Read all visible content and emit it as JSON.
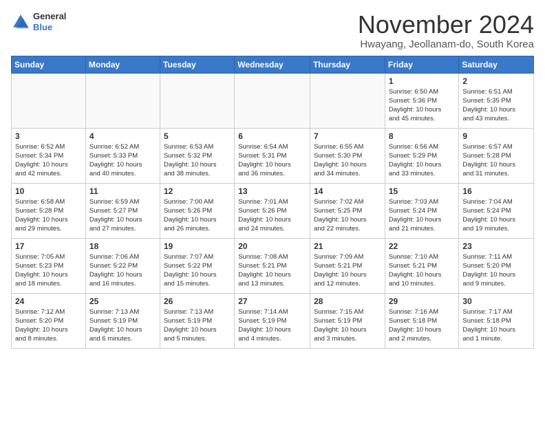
{
  "logo": {
    "general": "General",
    "blue": "Blue"
  },
  "title": "November 2024",
  "location": "Hwayang, Jeollanam-do, South Korea",
  "weekdays": [
    "Sunday",
    "Monday",
    "Tuesday",
    "Wednesday",
    "Thursday",
    "Friday",
    "Saturday"
  ],
  "weeks": [
    [
      {
        "day": "",
        "info": ""
      },
      {
        "day": "",
        "info": ""
      },
      {
        "day": "",
        "info": ""
      },
      {
        "day": "",
        "info": ""
      },
      {
        "day": "",
        "info": ""
      },
      {
        "day": "1",
        "info": "Sunrise: 6:50 AM\nSunset: 5:36 PM\nDaylight: 10 hours\nand 45 minutes."
      },
      {
        "day": "2",
        "info": "Sunrise: 6:51 AM\nSunset: 5:35 PM\nDaylight: 10 hours\nand 43 minutes."
      }
    ],
    [
      {
        "day": "3",
        "info": "Sunrise: 6:52 AM\nSunset: 5:34 PM\nDaylight: 10 hours\nand 42 minutes."
      },
      {
        "day": "4",
        "info": "Sunrise: 6:52 AM\nSunset: 5:33 PM\nDaylight: 10 hours\nand 40 minutes."
      },
      {
        "day": "5",
        "info": "Sunrise: 6:53 AM\nSunset: 5:32 PM\nDaylight: 10 hours\nand 38 minutes."
      },
      {
        "day": "6",
        "info": "Sunrise: 6:54 AM\nSunset: 5:31 PM\nDaylight: 10 hours\nand 36 minutes."
      },
      {
        "day": "7",
        "info": "Sunrise: 6:55 AM\nSunset: 5:30 PM\nDaylight: 10 hours\nand 34 minutes."
      },
      {
        "day": "8",
        "info": "Sunrise: 6:56 AM\nSunset: 5:29 PM\nDaylight: 10 hours\nand 33 minutes."
      },
      {
        "day": "9",
        "info": "Sunrise: 6:57 AM\nSunset: 5:28 PM\nDaylight: 10 hours\nand 31 minutes."
      }
    ],
    [
      {
        "day": "10",
        "info": "Sunrise: 6:58 AM\nSunset: 5:28 PM\nDaylight: 10 hours\nand 29 minutes."
      },
      {
        "day": "11",
        "info": "Sunrise: 6:59 AM\nSunset: 5:27 PM\nDaylight: 10 hours\nand 27 minutes."
      },
      {
        "day": "12",
        "info": "Sunrise: 7:00 AM\nSunset: 5:26 PM\nDaylight: 10 hours\nand 26 minutes."
      },
      {
        "day": "13",
        "info": "Sunrise: 7:01 AM\nSunset: 5:26 PM\nDaylight: 10 hours\nand 24 minutes."
      },
      {
        "day": "14",
        "info": "Sunrise: 7:02 AM\nSunset: 5:25 PM\nDaylight: 10 hours\nand 22 minutes."
      },
      {
        "day": "15",
        "info": "Sunrise: 7:03 AM\nSunset: 5:24 PM\nDaylight: 10 hours\nand 21 minutes."
      },
      {
        "day": "16",
        "info": "Sunrise: 7:04 AM\nSunset: 5:24 PM\nDaylight: 10 hours\nand 19 minutes."
      }
    ],
    [
      {
        "day": "17",
        "info": "Sunrise: 7:05 AM\nSunset: 5:23 PM\nDaylight: 10 hours\nand 18 minutes."
      },
      {
        "day": "18",
        "info": "Sunrise: 7:06 AM\nSunset: 5:22 PM\nDaylight: 10 hours\nand 16 minutes."
      },
      {
        "day": "19",
        "info": "Sunrise: 7:07 AM\nSunset: 5:22 PM\nDaylight: 10 hours\nand 15 minutes."
      },
      {
        "day": "20",
        "info": "Sunrise: 7:08 AM\nSunset: 5:21 PM\nDaylight: 10 hours\nand 13 minutes."
      },
      {
        "day": "21",
        "info": "Sunrise: 7:09 AM\nSunset: 5:21 PM\nDaylight: 10 hours\nand 12 minutes."
      },
      {
        "day": "22",
        "info": "Sunrise: 7:10 AM\nSunset: 5:21 PM\nDaylight: 10 hours\nand 10 minutes."
      },
      {
        "day": "23",
        "info": "Sunrise: 7:11 AM\nSunset: 5:20 PM\nDaylight: 10 hours\nand 9 minutes."
      }
    ],
    [
      {
        "day": "24",
        "info": "Sunrise: 7:12 AM\nSunset: 5:20 PM\nDaylight: 10 hours\nand 8 minutes."
      },
      {
        "day": "25",
        "info": "Sunrise: 7:13 AM\nSunset: 5:19 PM\nDaylight: 10 hours\nand 6 minutes."
      },
      {
        "day": "26",
        "info": "Sunrise: 7:13 AM\nSunset: 5:19 PM\nDaylight: 10 hours\nand 5 minutes."
      },
      {
        "day": "27",
        "info": "Sunrise: 7:14 AM\nSunset: 5:19 PM\nDaylight: 10 hours\nand 4 minutes."
      },
      {
        "day": "28",
        "info": "Sunrise: 7:15 AM\nSunset: 5:19 PM\nDaylight: 10 hours\nand 3 minutes."
      },
      {
        "day": "29",
        "info": "Sunrise: 7:16 AM\nSunset: 5:18 PM\nDaylight: 10 hours\nand 2 minutes."
      },
      {
        "day": "30",
        "info": "Sunrise: 7:17 AM\nSunset: 5:18 PM\nDaylight: 10 hours\nand 1 minute."
      }
    ]
  ]
}
